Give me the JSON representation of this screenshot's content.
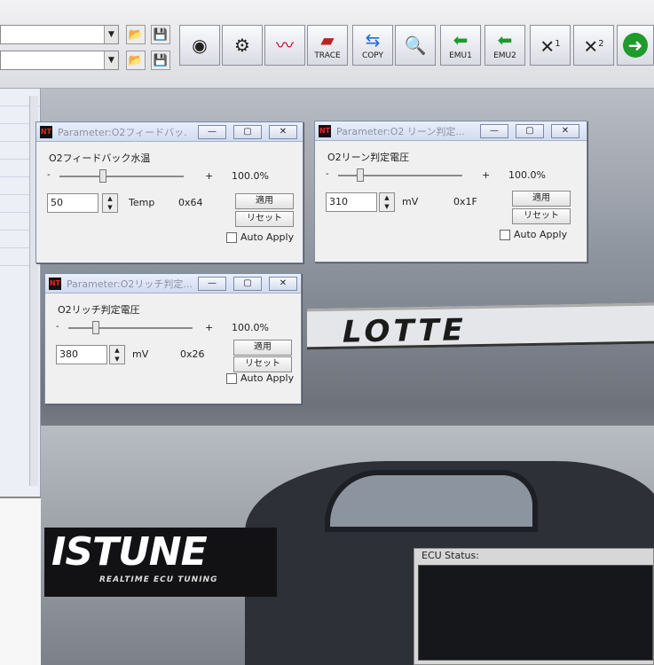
{
  "toolbar": {
    "buttons": [
      {
        "name": "record-button",
        "label": "",
        "icon": "camera-lens-icon"
      },
      {
        "name": "gauges-button",
        "label": "",
        "icon": "gauges-icon"
      },
      {
        "name": "graph-button",
        "label": "",
        "icon": "graph-icon"
      },
      {
        "name": "trace-button",
        "label": "TRACE",
        "icon": "trace-icon"
      },
      {
        "name": "copy-button",
        "label": "COPY",
        "icon": "copy-arrows-icon"
      },
      {
        "name": "search-button",
        "label": "",
        "icon": "magnifier-icon"
      },
      {
        "name": "emu1-button",
        "label": "EMU1",
        "icon": "green-arrow-icon"
      },
      {
        "name": "emu2-button",
        "label": "EMU2",
        "icon": "green-arrow-icon"
      },
      {
        "name": "map1-button",
        "label": "1",
        "icon": "map-switch-icon"
      },
      {
        "name": "map2-button",
        "label": "2",
        "icon": "map-switch-icon"
      },
      {
        "name": "go-button",
        "label": "",
        "icon": "green-go-icon"
      }
    ]
  },
  "windows": [
    {
      "title": "Parameter:O2フィードバッ...",
      "param_name": "O2フィードバック水温",
      "min_label": "-",
      "max_label": "+",
      "percent": "100.0%",
      "value": "50",
      "unit": "Temp",
      "hex": "0x64",
      "apply_label": "適用",
      "reset_label": "リセット",
      "auto_apply_label": "Auto Apply",
      "slider_level": 0.35
    },
    {
      "title": "Parameter:O2 リーン判定...",
      "param_name": "O2リーン判定電圧",
      "min_label": "-",
      "max_label": "+",
      "percent": "100.0%",
      "value": "310",
      "unit": "mV",
      "hex": "0x1F",
      "apply_label": "適用",
      "reset_label": "リセット",
      "auto_apply_label": "Auto Apply",
      "slider_level": 0.18
    },
    {
      "title": "Parameter:O2リッチ判定...",
      "param_name": "O2リッチ判定電圧",
      "min_label": "-",
      "max_label": "+",
      "percent": "100.0%",
      "value": "380",
      "unit": "mV",
      "hex": "0x26",
      "apply_label": "適用",
      "reset_label": "リセット",
      "auto_apply_label": "Auto Apply",
      "slider_level": 0.22
    }
  ],
  "desktop": {
    "billboard_text": "LOTTE",
    "logo_text": "ISTUNE",
    "logo_subtext": "REALTIME ECU TUNING"
  },
  "ecu_status": {
    "label": "ECU Status:"
  }
}
